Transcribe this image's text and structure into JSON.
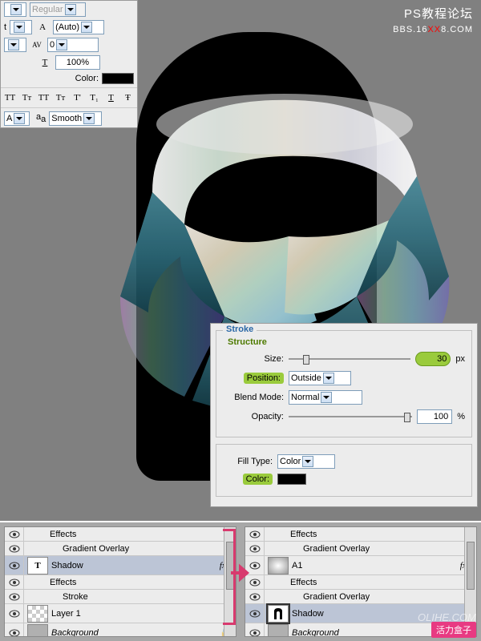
{
  "watermark": {
    "line1": "PS教程论坛",
    "line2a": "BBS.16",
    "xx": "XX",
    "line2b": "8.COM"
  },
  "char": {
    "style": "Regular",
    "leading": "(Auto)",
    "tracking": "0",
    "scale": "100%",
    "color_label": "Color:",
    "aa_prefix": "a",
    "aa_value": "Smooth",
    "tt": [
      "TT",
      "Tт",
      "TT",
      "Tт",
      "T'",
      "T₁",
      "T",
      "Ŧ"
    ]
  },
  "stroke": {
    "title": "Stroke",
    "group": "Structure",
    "size_label": "Size:",
    "size": "30",
    "px": "px",
    "position_label": "Position:",
    "position": "Outside",
    "blend_label": "Blend Mode:",
    "blend": "Normal",
    "opacity_label": "Opacity:",
    "opacity": "100",
    "pct": "%",
    "fill_label": "Fill Type:",
    "fill": "Color",
    "color_label": "Color:"
  },
  "layersL": {
    "effects": "Effects",
    "gradov": "Gradient Overlay",
    "shadow": "Shadow",
    "strokefx": "Stroke",
    "layer1": "Layer 1",
    "bg": "Background"
  },
  "layersR": {
    "effects": "Effects",
    "gradov": "Gradient Overlay",
    "a1": "A1",
    "shadow": "Shadow",
    "bg": "Background"
  },
  "footer": {
    "box": "活力盒子",
    "olihe": "OLIHE.COM"
  }
}
